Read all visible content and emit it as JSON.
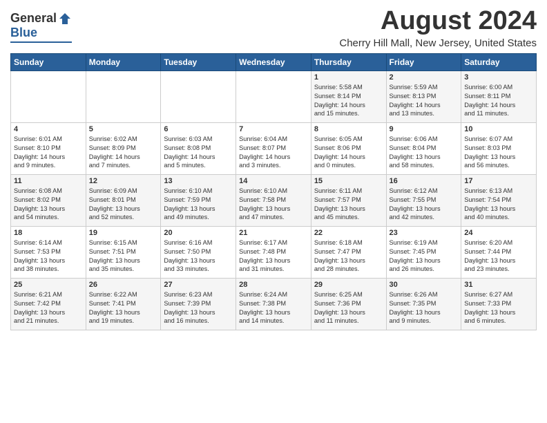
{
  "header": {
    "logo_general": "General",
    "logo_blue": "Blue",
    "month": "August 2024",
    "location": "Cherry Hill Mall, New Jersey, United States"
  },
  "weekdays": [
    "Sunday",
    "Monday",
    "Tuesday",
    "Wednesday",
    "Thursday",
    "Friday",
    "Saturday"
  ],
  "rows": [
    [
      {
        "day": "",
        "info": ""
      },
      {
        "day": "",
        "info": ""
      },
      {
        "day": "",
        "info": ""
      },
      {
        "day": "",
        "info": ""
      },
      {
        "day": "1",
        "info": "Sunrise: 5:58 AM\nSunset: 8:14 PM\nDaylight: 14 hours\nand 15 minutes."
      },
      {
        "day": "2",
        "info": "Sunrise: 5:59 AM\nSunset: 8:13 PM\nDaylight: 14 hours\nand 13 minutes."
      },
      {
        "day": "3",
        "info": "Sunrise: 6:00 AM\nSunset: 8:11 PM\nDaylight: 14 hours\nand 11 minutes."
      }
    ],
    [
      {
        "day": "4",
        "info": "Sunrise: 6:01 AM\nSunset: 8:10 PM\nDaylight: 14 hours\nand 9 minutes."
      },
      {
        "day": "5",
        "info": "Sunrise: 6:02 AM\nSunset: 8:09 PM\nDaylight: 14 hours\nand 7 minutes."
      },
      {
        "day": "6",
        "info": "Sunrise: 6:03 AM\nSunset: 8:08 PM\nDaylight: 14 hours\nand 5 minutes."
      },
      {
        "day": "7",
        "info": "Sunrise: 6:04 AM\nSunset: 8:07 PM\nDaylight: 14 hours\nand 3 minutes."
      },
      {
        "day": "8",
        "info": "Sunrise: 6:05 AM\nSunset: 8:06 PM\nDaylight: 14 hours\nand 0 minutes."
      },
      {
        "day": "9",
        "info": "Sunrise: 6:06 AM\nSunset: 8:04 PM\nDaylight: 13 hours\nand 58 minutes."
      },
      {
        "day": "10",
        "info": "Sunrise: 6:07 AM\nSunset: 8:03 PM\nDaylight: 13 hours\nand 56 minutes."
      }
    ],
    [
      {
        "day": "11",
        "info": "Sunrise: 6:08 AM\nSunset: 8:02 PM\nDaylight: 13 hours\nand 54 minutes."
      },
      {
        "day": "12",
        "info": "Sunrise: 6:09 AM\nSunset: 8:01 PM\nDaylight: 13 hours\nand 52 minutes."
      },
      {
        "day": "13",
        "info": "Sunrise: 6:10 AM\nSunset: 7:59 PM\nDaylight: 13 hours\nand 49 minutes."
      },
      {
        "day": "14",
        "info": "Sunrise: 6:10 AM\nSunset: 7:58 PM\nDaylight: 13 hours\nand 47 minutes."
      },
      {
        "day": "15",
        "info": "Sunrise: 6:11 AM\nSunset: 7:57 PM\nDaylight: 13 hours\nand 45 minutes."
      },
      {
        "day": "16",
        "info": "Sunrise: 6:12 AM\nSunset: 7:55 PM\nDaylight: 13 hours\nand 42 minutes."
      },
      {
        "day": "17",
        "info": "Sunrise: 6:13 AM\nSunset: 7:54 PM\nDaylight: 13 hours\nand 40 minutes."
      }
    ],
    [
      {
        "day": "18",
        "info": "Sunrise: 6:14 AM\nSunset: 7:53 PM\nDaylight: 13 hours\nand 38 minutes."
      },
      {
        "day": "19",
        "info": "Sunrise: 6:15 AM\nSunset: 7:51 PM\nDaylight: 13 hours\nand 35 minutes."
      },
      {
        "day": "20",
        "info": "Sunrise: 6:16 AM\nSunset: 7:50 PM\nDaylight: 13 hours\nand 33 minutes."
      },
      {
        "day": "21",
        "info": "Sunrise: 6:17 AM\nSunset: 7:48 PM\nDaylight: 13 hours\nand 31 minutes."
      },
      {
        "day": "22",
        "info": "Sunrise: 6:18 AM\nSunset: 7:47 PM\nDaylight: 13 hours\nand 28 minutes."
      },
      {
        "day": "23",
        "info": "Sunrise: 6:19 AM\nSunset: 7:45 PM\nDaylight: 13 hours\nand 26 minutes."
      },
      {
        "day": "24",
        "info": "Sunrise: 6:20 AM\nSunset: 7:44 PM\nDaylight: 13 hours\nand 23 minutes."
      }
    ],
    [
      {
        "day": "25",
        "info": "Sunrise: 6:21 AM\nSunset: 7:42 PM\nDaylight: 13 hours\nand 21 minutes."
      },
      {
        "day": "26",
        "info": "Sunrise: 6:22 AM\nSunset: 7:41 PM\nDaylight: 13 hours\nand 19 minutes."
      },
      {
        "day": "27",
        "info": "Sunrise: 6:23 AM\nSunset: 7:39 PM\nDaylight: 13 hours\nand 16 minutes."
      },
      {
        "day": "28",
        "info": "Sunrise: 6:24 AM\nSunset: 7:38 PM\nDaylight: 13 hours\nand 14 minutes."
      },
      {
        "day": "29",
        "info": "Sunrise: 6:25 AM\nSunset: 7:36 PM\nDaylight: 13 hours\nand 11 minutes."
      },
      {
        "day": "30",
        "info": "Sunrise: 6:26 AM\nSunset: 7:35 PM\nDaylight: 13 hours\nand 9 minutes."
      },
      {
        "day": "31",
        "info": "Sunrise: 6:27 AM\nSunset: 7:33 PM\nDaylight: 13 hours\nand 6 minutes."
      }
    ]
  ]
}
